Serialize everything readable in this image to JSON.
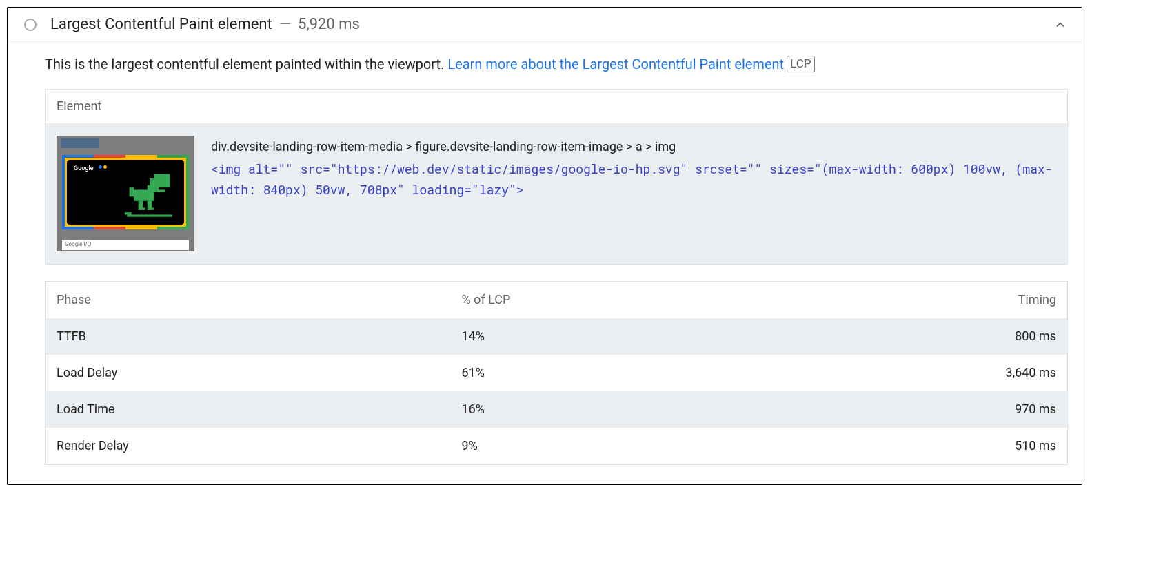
{
  "header": {
    "title": "Largest Contentful Paint element",
    "separator": "—",
    "value": "5,920 ms"
  },
  "description": {
    "text_before_link": "This is the largest contentful element painted within the viewport. ",
    "link_text": "Learn more about the Largest Contentful Paint element",
    "badge": "LCP"
  },
  "element_section": {
    "header": "Element",
    "selector": "div.devsite-landing-row-item-media > figure.devsite-landing-row-item-image > a > img",
    "html": "<img alt=\"\" src=\"https://web.dev/static/images/google-io-hp.svg\" srcset=\"\" sizes=\"(max-width: 600px) 100vw, (max-width: 840px) 50vw, 708px\" loading=\"lazy\">",
    "thumb_label": "Google",
    "thumb_caption": "Google I/O"
  },
  "phases": {
    "columns": [
      "Phase",
      "% of LCP",
      "Timing"
    ],
    "rows": [
      {
        "phase": "TTFB",
        "pct": "14%",
        "timing": "800 ms"
      },
      {
        "phase": "Load Delay",
        "pct": "61%",
        "timing": "3,640 ms"
      },
      {
        "phase": "Load Time",
        "pct": "16%",
        "timing": "970 ms"
      },
      {
        "phase": "Render Delay",
        "pct": "9%",
        "timing": "510 ms"
      }
    ]
  }
}
